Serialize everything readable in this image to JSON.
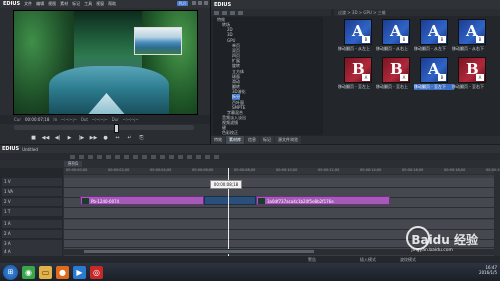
{
  "player": {
    "logo": "EDIUS",
    "menu": [
      "文件",
      "编辑",
      "视图",
      "素材",
      "标记",
      "工具",
      "视窗",
      "帮助"
    ],
    "mode_tag": "PLR",
    "cur_label": "Cur",
    "cur_tc": "00:00:07;18",
    "in_label": "In",
    "in_tc": "--:--:--;--",
    "out_label": "Out",
    "out_tc": "--:--:--;--",
    "dur_label": "Dur",
    "dur_tc": "--:--:--;--",
    "transport": [
      "■",
      "◀◀",
      "◀|",
      "▶",
      "|▶",
      "▶▶",
      "●",
      "↔",
      "↵",
      "⎘"
    ]
  },
  "bin": {
    "logo": "EDIUS",
    "grid_header": "过渡 > 3D > GPU > 三维",
    "tree": [
      "特效",
      "转场",
      "2D",
      "3D",
      "GPU",
      "单页",
      "双页",
      "四页",
      "扩展",
      "旋转",
      "立方体",
      "球面",
      "滑动",
      "翻转",
      "3D溶化",
      "拆分",
      "百叶窗",
      "SMPTE",
      "字幕混合",
      "音频淡入淡出",
      "视频滤镜",
      "键",
      "色彩校正",
      "标题",
      "视频 滤镜",
      "音频 滤镜"
    ],
    "selected_tree_index": 15,
    "thumbs": [
      {
        "letter": "A",
        "kind": "a",
        "caption": "移动翻页 - 从左上"
      },
      {
        "letter": "A",
        "kind": "a",
        "caption": "移动翻页 - 从右上"
      },
      {
        "letter": "A",
        "kind": "a",
        "caption": "移动翻页 - 从左下"
      },
      {
        "letter": "A",
        "kind": "a",
        "caption": "移动翻页 - 从右下"
      },
      {
        "letter": "B",
        "kind": "b",
        "caption": "移动翻页 - 至左上"
      },
      {
        "letter": "B",
        "kind": "b",
        "caption": "移动翻页 - 至右上"
      },
      {
        "letter": "A",
        "kind": "a",
        "caption": "移动翻页 - 至左下"
      },
      {
        "letter": "B",
        "kind": "b",
        "caption": "移动翻页 - 至右下"
      }
    ],
    "selected_thumb": 6,
    "tabs": [
      "特效",
      "素材库",
      "信息",
      "标记",
      "源文件浏览"
    ],
    "active_tab": 1
  },
  "timeline": {
    "logo": "EDIUS",
    "project": "Untitled",
    "sequence_tab": "序列1",
    "ruler": [
      "00:00:00;00",
      "00:00:02;00",
      "00:00:04;00",
      "00:00:06;00",
      "00:00:08;00",
      "00:00:10;00",
      "00:00:12;00",
      "00:00:14;00",
      "00:00:16;00",
      "00:00:18;00",
      "00:00:20;00"
    ],
    "tracks": [
      "1 V",
      "1 VA",
      "2 V",
      "1 T",
      "1 A",
      "2 A",
      "3 A",
      "4 A"
    ],
    "clip_left": "Pb-1240-0074",
    "clip_right": "3a0df737aca4c1b20f5e8b2f176e",
    "playhead_tc": "00:00:08;18",
    "status_left": "警告",
    "status_mid": "插入模式",
    "status_right": "波纹模式"
  },
  "taskbar": {
    "time": "16:47",
    "date": "2016/1/5"
  },
  "watermark": {
    "text": "Baidu 经验",
    "url": "jingyan.baidu.com"
  }
}
